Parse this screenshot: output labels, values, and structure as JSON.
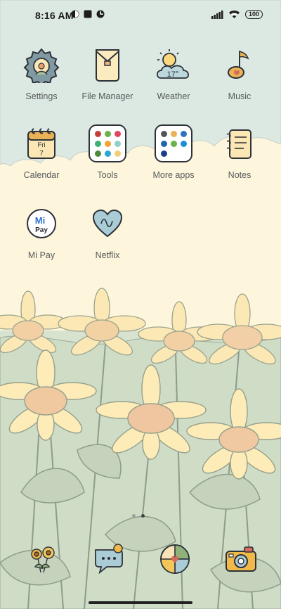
{
  "status": {
    "time": "8:16 AM",
    "battery": "100"
  },
  "apps": [
    {
      "label": "Settings",
      "icon": "gear-flower-icon"
    },
    {
      "label": "File Manager",
      "icon": "envelope-folder-icon"
    },
    {
      "label": "Weather",
      "icon": "sun-cloud-icon",
      "temp": "17°"
    },
    {
      "label": "Music",
      "icon": "music-note-icon"
    },
    {
      "label": "Calendar",
      "icon": "calendar-icon",
      "day": "Fri",
      "date": "7"
    },
    {
      "label": "Tools",
      "icon": "folder-icon"
    },
    {
      "label": "More apps",
      "icon": "folder-icon"
    },
    {
      "label": "Notes",
      "icon": "notepad-icon"
    },
    {
      "label": "Mi Pay",
      "icon": "mi-pay-icon",
      "logo_text": "Mi",
      "logo_sub": "Pay"
    },
    {
      "label": "Netflix",
      "icon": "heart-icon"
    }
  ],
  "dock": [
    {
      "name": "flowers-icon"
    },
    {
      "name": "chat-bubble-icon"
    },
    {
      "name": "photos-ball-icon"
    },
    {
      "name": "camera-icon"
    }
  ],
  "colors": {
    "sky": "#dde9e3",
    "cream": "#fdf6dc",
    "petal": "#fbe9b6",
    "leaf": "#c8d6bf",
    "outline": "#7d8a7a"
  }
}
